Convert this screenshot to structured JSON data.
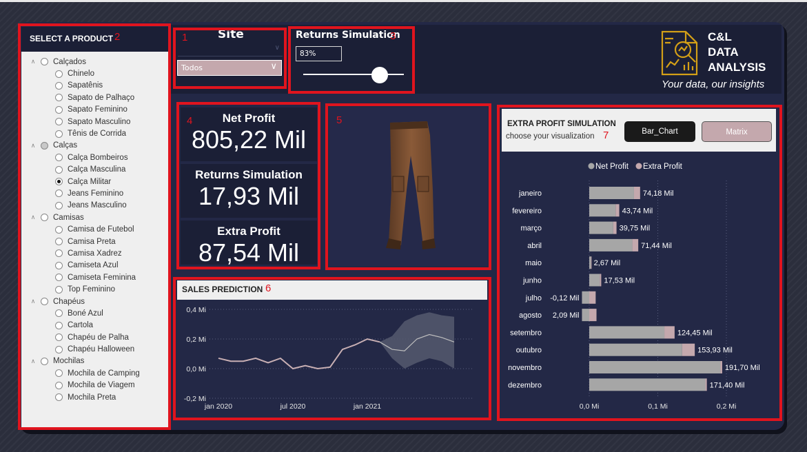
{
  "slicer": {
    "title": "SELECT A PRODUCT",
    "categories": [
      {
        "label": "Calçados",
        "state": "empty",
        "items": [
          "Chinelo",
          "Sapatênis",
          "Sapato de Palhaço",
          "Sapato Feminino",
          "Sapato Masculino",
          "Tênis de Corrida"
        ],
        "selected": null
      },
      {
        "label": "Calças",
        "state": "partial",
        "items": [
          "Calça Bombeiros",
          "Calça Masculina",
          "Calça Militar",
          "Jeans Feminino",
          "Jeans Masculino"
        ],
        "selected": "Calça Militar"
      },
      {
        "label": "Camisas",
        "state": "empty",
        "items": [
          "Camisa de Futebol",
          "Camisa Preta",
          "Camisa Xadrez",
          "Camiseta Azul",
          "Camiseta Feminina",
          "Top Feminino"
        ],
        "selected": null
      },
      {
        "label": "Chapéus",
        "state": "empty",
        "items": [
          "Boné Azul",
          "Cartola",
          "Chapéu de Palha",
          "Chapéu Halloween"
        ],
        "selected": null
      },
      {
        "label": "Mochilas",
        "state": "empty",
        "items": [
          "Mochila de Camping",
          "Mochila de Viagem",
          "Mochila Preta"
        ],
        "selected": null
      }
    ]
  },
  "site": {
    "title": "Site",
    "selected": "Todos"
  },
  "returns": {
    "title": "Returns Simulation",
    "value": "83%",
    "slider_fraction": 0.83
  },
  "logo": {
    "line1": "C&L",
    "line2": "DATA",
    "line3": "ANALYSIS",
    "tagline": "Your data, our insights",
    "icon": "analytics-logo-icon",
    "color": "#d4a017"
  },
  "kpis": [
    {
      "label": "Net Profit",
      "value": "805,22 Mil"
    },
    {
      "label": "Returns Simulation",
      "value": "17,93 Mil"
    },
    {
      "label": "Extra Profit",
      "value": "87,54 Mil"
    }
  ],
  "product_image": {
    "icon": "cargo-pants-image"
  },
  "badges": [
    "1",
    "2",
    "3",
    "4",
    "5",
    "6",
    "7"
  ],
  "colors": {
    "accent_red": "#e0141e",
    "net_profit": "#a6a6a6",
    "extra_profit": "#c4a8ad",
    "panel": "#1b1f36",
    "background": "#232846"
  },
  "sales_prediction": {
    "title": "SALES PREDICTION"
  },
  "extra_profit": {
    "title": "EXTRA PROFIT SIMULATION",
    "subtitle": "choose your visualization",
    "btn_bar": "Bar_Chart",
    "btn_matrix": "Matrix"
  },
  "chart_data": [
    {
      "type": "line",
      "title": "SALES PREDICTION",
      "x_ticks": [
        "jan 2020",
        "jul 2020",
        "jan 2021"
      ],
      "y_ticks": [
        "0,4 Mi",
        "0,2 Mi",
        "0,0 Mi",
        "-0,2 Mi"
      ],
      "ylim": [
        -0.2,
        0.4
      ],
      "series": [
        {
          "values": [
            0.07,
            0.05,
            0.05,
            0.07,
            0.04,
            0.07,
            0.0,
            0.02,
            0.0,
            0.01,
            0.13,
            0.16,
            0.2,
            0.18
          ]
        },
        {
          "values": [
            0.18,
            0.13,
            0.12,
            0.2,
            0.23,
            0.21,
            0.18
          ]
        }
      ],
      "forecast_band": {
        "lower": [
          0.18,
          0.07,
          0.0,
          0.04,
          0.07,
          0.05,
          0.0
        ],
        "upper": [
          0.18,
          0.22,
          0.32,
          0.36,
          0.38,
          0.36,
          0.35
        ]
      },
      "grid": true
    },
    {
      "type": "bar",
      "title": "EXTRA PROFIT SIMULATION",
      "legend": [
        "Net Profit",
        "Extra Profit"
      ],
      "legend_position": "top-center",
      "categories": [
        "janeiro",
        "fevereiro",
        "março",
        "abril",
        "maio",
        "junho",
        "julho",
        "agosto",
        "setembro",
        "outubro",
        "novembro",
        "dezembro"
      ],
      "series": [
        {
          "name": "Net Profit",
          "values": [
            0.0653,
            0.0385,
            0.035,
            0.0629,
            0.0024,
            0.0154,
            -0.0106,
            -0.0106,
            0.1096,
            0.1355,
            0.1914,
            0.1694
          ]
        },
        {
          "name": "Extra Profit",
          "values": [
            0.0089,
            0.0053,
            0.0048,
            0.0086,
            0.0003,
            0.0021,
            0.0094,
            0.0106,
            0.0149,
            0.0184,
            0.0025,
            0.0021
          ]
        }
      ],
      "data_labels": [
        "74,18 Mil",
        "43,74 Mil",
        "39,75 Mil",
        "71,44 Mil",
        "2,67 Mil",
        "17,53 Mil",
        "-0,12 Mil",
        "2,09 Mil",
        "124,45 Mil",
        "153,93 Mil",
        "191,70 Mil",
        "171,40 Mil"
      ],
      "x_ticks": [
        "0,0 Mi",
        "0,1 Mi",
        "0,2 Mi"
      ],
      "xlim": [
        0,
        0.2
      ]
    }
  ]
}
